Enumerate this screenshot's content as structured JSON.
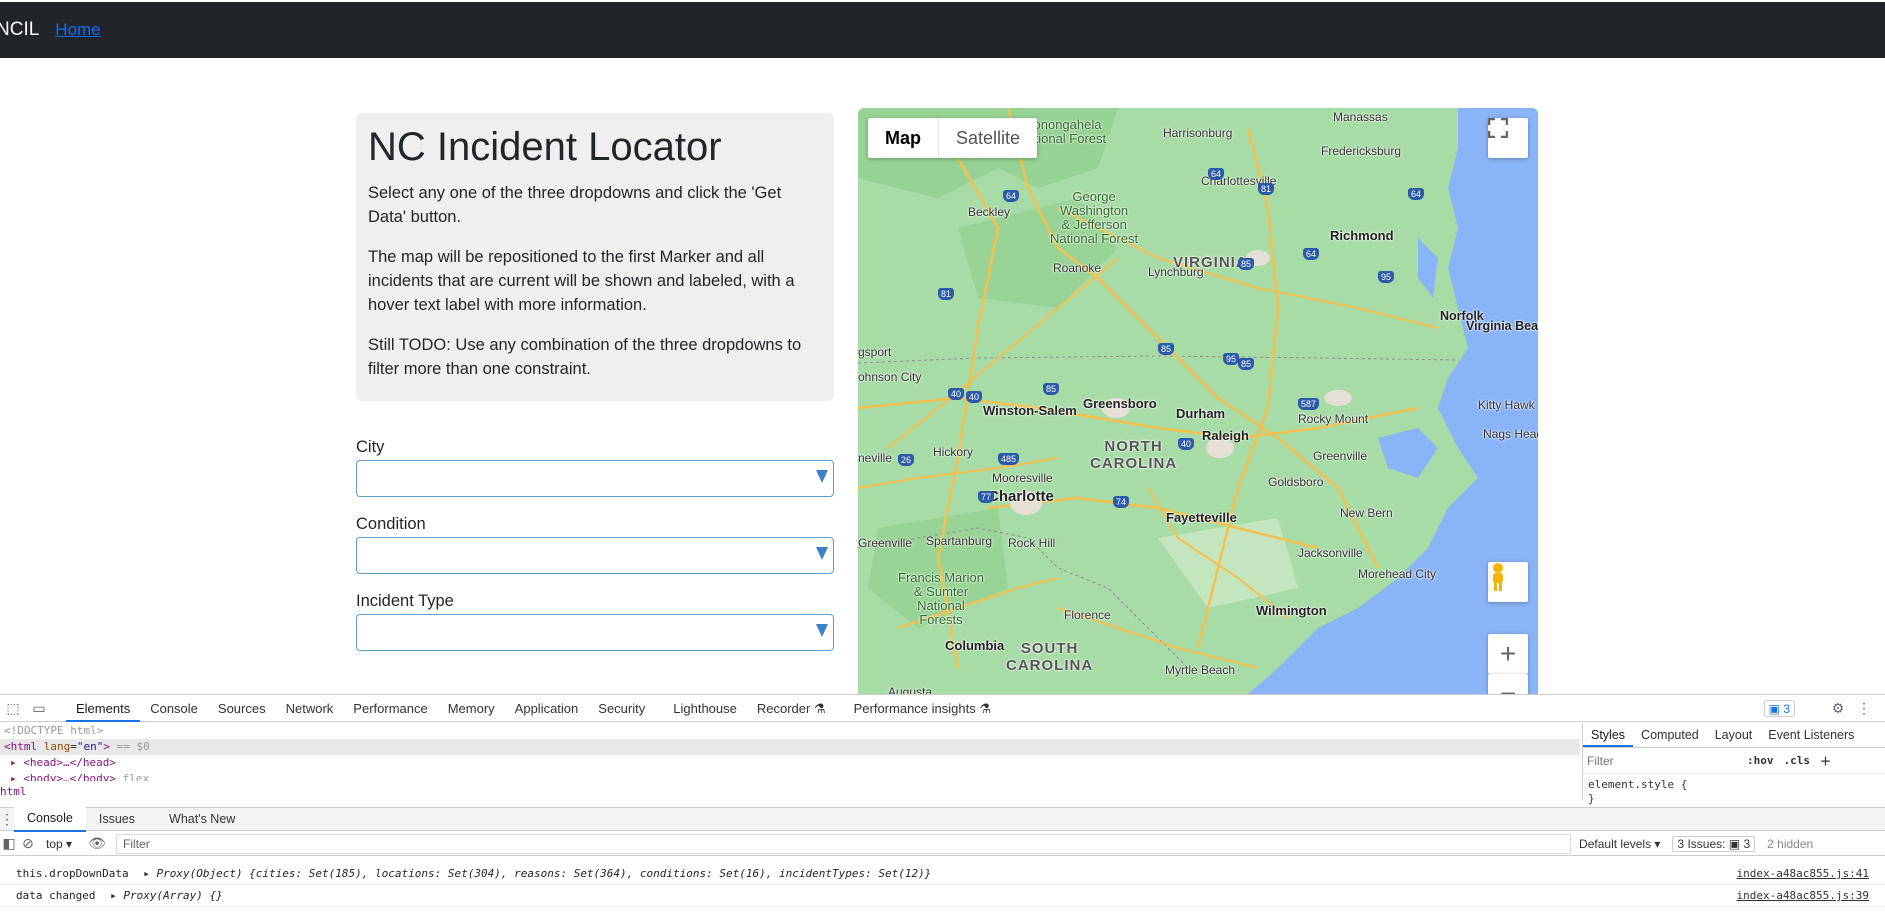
{
  "navbar": {
    "brand": "NCIL",
    "home_link": "Home"
  },
  "info": {
    "title": "NC Incident Locator",
    "p1": "Select any one of the three dropdowns and click the 'Get Data' button.",
    "p2": "The map will be repositioned to the first Marker and all incidents that are current will be shown and labeled, with a hover text label with more information.",
    "p3": "Still TODO: Use any combination of the three dropdowns to filter more than one constraint."
  },
  "form": {
    "city_label": "City",
    "condition_label": "Condition",
    "incident_type_label": "Incident Type"
  },
  "map": {
    "type_map": "Map",
    "type_satellite": "Satellite",
    "zoom_in": "+",
    "zoom_out": "−",
    "places": {
      "monongahela": "Monongahela\nNational Forest",
      "harrisonburg": "Harrisonburg",
      "manassas": "Manassas",
      "fredericksburg": "Fredericksburg",
      "charlottesville": "Charlottesville",
      "george_washington": "George\nWashington\n& Jefferson\nNational Forest",
      "beckley": "Beckley",
      "richmond": "Richmond",
      "virginia": "VIRGINIA",
      "roanoke": "Roanoke",
      "lynchburg": "Lynchburg",
      "norfolk": "Norfolk",
      "virginia_beach": "Virginia Bea",
      "gsport": "gsport",
      "johnson_city": "ohnson City",
      "kitty_hawk": "Kitty Hawk",
      "greensboro": "Greensboro",
      "winston_salem": "Winston-Salem",
      "durham": "Durham",
      "rocky_mount": "Rocky Mount",
      "nags_head": "Nags Head",
      "raleigh": "Raleigh",
      "north_carolina": "NORTH\nCAROLINA",
      "hickory": "Hickory",
      "greenville_nc": "Greenville",
      "neville": "neville",
      "mooresville": "Mooresville",
      "goldsboro": "Goldsboro",
      "charlotte": "Charlotte",
      "fayetteville": "Fayetteville",
      "new_bern": "New Bern",
      "greenville_sc": "Greenville",
      "spartanburg": "Spartanburg",
      "rock_hill": "Rock Hill",
      "jacksonville": "Jacksonville",
      "morehead_city": "Morehead City",
      "francis_marion": "Francis Marion\n& Sumter\nNational\nForests",
      "florence": "Florence",
      "wilmington": "Wilmington",
      "columbia": "Columbia",
      "south_carolina": "SOUTH\nCAROLINA",
      "myrtle_beach": "Myrtle Beach",
      "augusta": "Augusta"
    },
    "shields": [
      "64",
      "81",
      "64",
      "64",
      "81",
      "85",
      "64",
      "40",
      "85",
      "95",
      "85",
      "40",
      "587",
      "85",
      "485",
      "26",
      "77",
      "40",
      "74",
      "95"
    ]
  },
  "devtools": {
    "tabs": [
      "Elements",
      "Console",
      "Sources",
      "Network",
      "Performance",
      "Memory",
      "Application",
      "Security",
      "Lighthouse",
      "Recorder ⚗",
      "Performance insights ⚗"
    ],
    "issues_count": "3",
    "elements": {
      "doctype": "<!DOCTYPE html>",
      "html_open_tag": "html",
      "html_attr_name": "lang",
      "html_attr_value": "\"en\"",
      "html_suffix": "== $0",
      "head_line": "<head>…</head>",
      "body_line": "<body>…</body>",
      "body_badge": "flex",
      "breadcrumb": "html"
    },
    "styles_tabs": [
      "Styles",
      "Computed",
      "Layout",
      "Event Listeners"
    ],
    "styles_filter_placeholder": "Filter",
    "styles_hov": ":hov",
    "styles_cls": ".cls",
    "element_style": "element.style {",
    "element_style_close": "}",
    "drawer_tabs": [
      "Console",
      "Issues",
      "What's New"
    ],
    "console_context": "top",
    "console_filter_placeholder": "Filter",
    "default_levels": "Default levels ▾",
    "issues_label": "3 Issues: ▣ 3",
    "hidden_label": "2 hidden",
    "messages": [
      {
        "prefix": "this.dropDownData",
        "body": "Proxy(Object) {cities: Set(185), locations: Set(304), reasons: Set(364), conditions: Set(16), incidentTypes: Set(12)}",
        "source": "index-a48ac855.js:41"
      },
      {
        "prefix": "data changed",
        "body": "Proxy(Array) {}",
        "source": "index-a48ac855.js:39"
      }
    ]
  }
}
